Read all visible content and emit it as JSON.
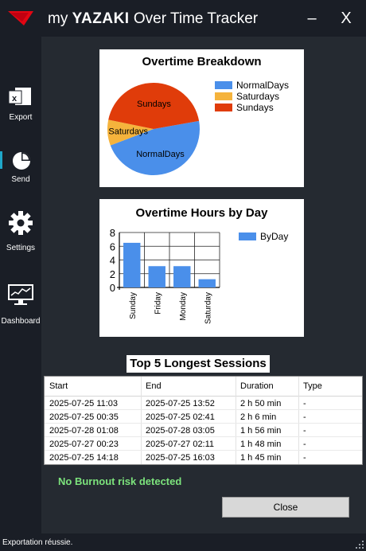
{
  "window": {
    "title_prefix": "my",
    "title_brand": "YAZAKI",
    "title_suffix": "Over Time Tracker",
    "minimize_label": "–",
    "close_label": "X"
  },
  "sidebar": {
    "items": [
      {
        "label": "Export",
        "icon": "excel-export-icon"
      },
      {
        "label": "Send",
        "icon": "pie-chart-icon"
      },
      {
        "label": "Settings",
        "icon": "gear-icon"
      },
      {
        "label": "Dashboard",
        "icon": "dashboard-monitor-icon"
      }
    ]
  },
  "pie_chart": {
    "title": "Overtime Breakdown",
    "legend": [
      "NormalDays",
      "Saturdays",
      "Sundays"
    ],
    "slice_labels": {
      "normal": "NormalDays",
      "saturdays": "Saturdays",
      "sundays": "Sundays"
    }
  },
  "bar_chart": {
    "title": "Overtime Hours by Day",
    "legend": "ByDay",
    "y_ticks": [
      "8",
      "6",
      "4",
      "2",
      "0"
    ]
  },
  "chart_data": [
    {
      "type": "pie",
      "title": "Overtime Breakdown",
      "categories": [
        "NormalDays",
        "Saturdays",
        "Sundays"
      ],
      "values": [
        47,
        9,
        44
      ],
      "colors": [
        "#4a8fea",
        "#f5b33c",
        "#e03c0a"
      ],
      "legend_position": "right"
    },
    {
      "type": "bar",
      "title": "Overtime Hours by Day",
      "categories": [
        "Sunday",
        "Friday",
        "Monday",
        "Saturday"
      ],
      "series": [
        {
          "name": "ByDay",
          "values": [
            6.5,
            3.1,
            3.1,
            1.2
          ]
        }
      ],
      "ylim": [
        0,
        8
      ],
      "grid": true,
      "legend_position": "top-right",
      "color": "#4a8fea"
    }
  ],
  "sessions": {
    "title": "Top 5 Longest Sessions",
    "columns": [
      "Start",
      "End",
      "Duration",
      "Type"
    ],
    "rows": [
      [
        "2025-07-25 11:03",
        "2025-07-25 13:52",
        "2 h 50 min",
        "-"
      ],
      [
        "2025-07-25 00:35",
        "2025-07-25 02:41",
        "2 h 6 min",
        "-"
      ],
      [
        "2025-07-28 01:08",
        "2025-07-28 03:05",
        "1 h 56 min",
        "-"
      ],
      [
        "2025-07-27 00:23",
        "2025-07-27 02:11",
        "1 h 48 min",
        "-"
      ],
      [
        "2025-07-25 14:18",
        "2025-07-25 16:03",
        "1 h 45 min",
        "-"
      ]
    ]
  },
  "status_text": "No Burnout risk detected",
  "close_button": "Close",
  "status_bar": "Exportation réussie.",
  "colors": {
    "accent": "#1fa7c9",
    "ok": "#7ce37c",
    "brand": "#e30613"
  }
}
